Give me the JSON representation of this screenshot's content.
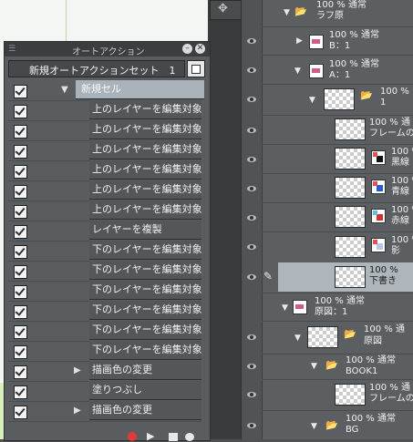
{
  "auto_action": {
    "title": "オートアクション",
    "set_name": "新規オートアクションセット　1",
    "items": [
      {
        "label": "新規セル",
        "group": true,
        "expand": "▼"
      },
      {
        "label": "上のレイヤーを編集対象"
      },
      {
        "label": "上のレイヤーを編集対象"
      },
      {
        "label": "上のレイヤーを編集対象"
      },
      {
        "label": "上のレイヤーを編集対象"
      },
      {
        "label": "上のレイヤーを編集対象"
      },
      {
        "label": "上のレイヤーを編集対象"
      },
      {
        "label": "レイヤーを複製"
      },
      {
        "label": "下のレイヤーを編集対象"
      },
      {
        "label": "下のレイヤーを編集対象"
      },
      {
        "label": "下のレイヤーを編集対象"
      },
      {
        "label": "下のレイヤーを編集対象"
      },
      {
        "label": "下のレイヤーを編集対象"
      },
      {
        "label": "下のレイヤーを編集対象"
      },
      {
        "label": "描画色の変更",
        "expand": "▶"
      },
      {
        "label": "塗りつぶし"
      },
      {
        "label": "描画色の変更",
        "expand": "▶"
      }
    ]
  },
  "layers": {
    "rafu": {
      "mode": "100 %  通常",
      "name": "ラフ原"
    },
    "b1": {
      "mode": "100 %  通常",
      "name": "B：1"
    },
    "a1": {
      "mode": "100 %  通常",
      "name": "A：1"
    },
    "cel1": {
      "mode": "100 %",
      "name": "1"
    },
    "frame1": {
      "mode": "100 % 通",
      "name": "フレームの□"
    },
    "kuro": {
      "mode": "100 %",
      "name": "黒線"
    },
    "ao": {
      "mode": "100 %",
      "name": "青線"
    },
    "aka": {
      "mode": "100 %",
      "name": "赤線"
    },
    "kage": {
      "mode": "100 %",
      "name": "影"
    },
    "shitagaki": {
      "mode": "100 %",
      "name": "下書き"
    },
    "genzu_folder": {
      "mode": "100 %  通常",
      "name": "原図：1"
    },
    "genzu": {
      "mode": "100 %  通",
      "name": "原図"
    },
    "book1": {
      "mode": "100 %  通常",
      "name": "BOOK1"
    },
    "frame2": {
      "mode": "100 % 通",
      "name": "フレームの□"
    },
    "bg": {
      "mode": "100 %  通常",
      "name": "BG"
    }
  },
  "colors": {
    "record": "#e23a3a",
    "selected_row": "#aeb6bc",
    "folder": "#f0d89a"
  }
}
